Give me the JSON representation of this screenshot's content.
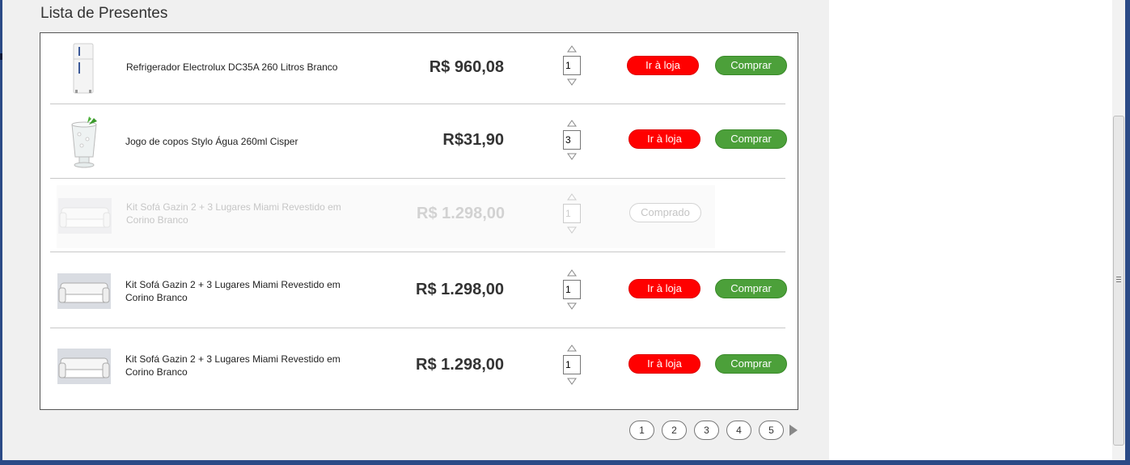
{
  "title": "Lista de Presentes",
  "colors": {
    "store_button": "#ff0000",
    "buy_button": "#4ca03a",
    "window_frame": "#2b4a86"
  },
  "items": [
    {
      "name": "Refrigerador Electrolux DC35A 260 Litros Branco",
      "price": "R$ 960,08",
      "qty": "1",
      "store_label": "Ir à loja",
      "buy_label": "Comprar",
      "image": "fridge-icon"
    },
    {
      "name": "Jogo de copos Stylo Água 260ml Cisper",
      "price": "R$31,90",
      "qty": "3",
      "store_label": "Ir à loja",
      "buy_label": "Comprar",
      "image": "glass-icon"
    },
    {
      "name": "Kit Sofá Gazin 2 + 3 Lugares Miami Revestido em Corino Branco",
      "price": "R$ 1.298,00",
      "qty": "1",
      "status_label": "Comprado",
      "image": "sofa-icon"
    },
    {
      "name": "Kit Sofá Gazin 2 + 3 Lugares Miami Revestido em Corino Branco",
      "price": "R$ 1.298,00",
      "qty": "1",
      "store_label": "Ir à loja",
      "buy_label": "Comprar",
      "image": "sofa-icon"
    },
    {
      "name": "Kit Sofá Gazin 2 + 3 Lugares Miami Revestido em Corino Branco",
      "price": "R$ 1.298,00",
      "qty": "1",
      "store_label": "Ir à loja",
      "buy_label": "Comprar",
      "image": "sofa-icon"
    }
  ],
  "pagination": {
    "pages": [
      "1",
      "2",
      "3",
      "4",
      "5"
    ],
    "next_icon": "next-arrow-icon"
  }
}
